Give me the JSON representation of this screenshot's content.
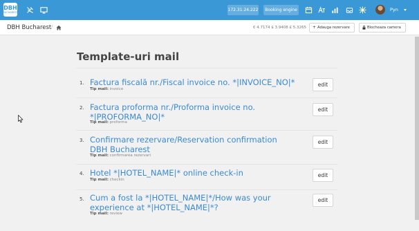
{
  "topbar": {
    "logo_text": "DBH",
    "logo_subtext": "BUCHAREST",
    "ip_address": "172.31.24.222",
    "booking_engine_label": "Booking engine",
    "user_name": "Pyn",
    "colors": {
      "background": "#3a98d6",
      "text": "#ffffff"
    }
  },
  "subbar": {
    "hotel_name": "DBH Bucharest",
    "separator": "/",
    "currency_rates": "€ 4.7174 $ 3.9408 £ 5.3265",
    "add_booking_label": "Adauga rezervare",
    "block_room_label": "Blocheaza camera"
  },
  "main": {
    "title": "Template-uri mail",
    "type_label": "Tip mail:",
    "edit_label": "edit",
    "templates": [
      {
        "number": "1.",
        "name": "Factura fiscală nr./Fiscal invoice no. *|INVOICE_NO|*",
        "type": "invoice"
      },
      {
        "number": "2.",
        "name": "Factura proforma nr./Proforma invoice no. *|PROFORMA_NO|*",
        "type": "proforma"
      },
      {
        "number": "3.",
        "name": "Confirmare rezervare/Reservation confirmation DBH Bucharest",
        "type": "confirmarea rezervari"
      },
      {
        "number": "4.",
        "name": "Hotel *|HOTEL_NAME|* online check-in",
        "type": "checkin"
      },
      {
        "number": "5.",
        "name": "Cum a fost la *|HOTEL_NAME|*/How was your experience at *|HOTEL_NAME|*?",
        "type": "review"
      }
    ],
    "link_color": "#3a8ad6"
  }
}
